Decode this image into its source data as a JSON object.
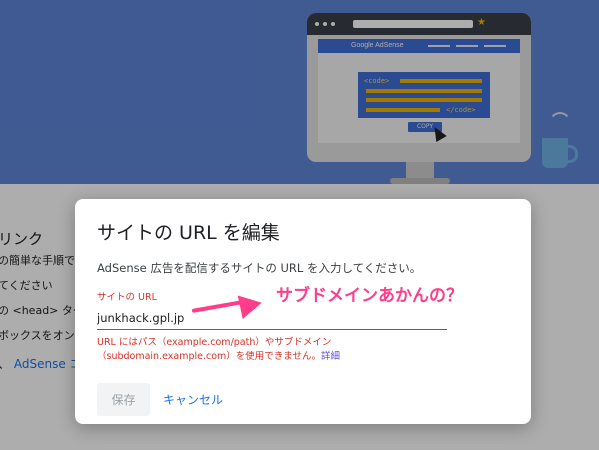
{
  "illustration": {
    "brand_text": "Google AdSense",
    "code_open": "<code>",
    "code_close": "</code>",
    "copy_label": "COPY"
  },
  "background_page": {
    "heading_fragment": "リンク",
    "lines": [
      "の簡単な手順で",
      "てください",
      "の <head> タグ",
      "ボックスをオン"
    ],
    "link_prefix": "、",
    "link_fragment": "AdSense コ"
  },
  "dialog": {
    "title": "サイトの URL を編集",
    "description": "AdSense 広告を配信するサイトの URL を入力してください。",
    "field": {
      "label": "サイトの URL",
      "value": "junkhack.gpl.jp",
      "error_line1": "URL にはパス（example.com/path）やサブドメイン",
      "error_line2": "（subdomain.example.com）を使用できません。",
      "error_link": "詳細"
    },
    "save_label": "保存",
    "cancel_label": "キャンセル"
  },
  "annotation": {
    "text": "サブドメインあかんの？"
  },
  "colors": {
    "hero": "#5f86d8",
    "error": "#d93025",
    "link": "#1a73e8",
    "annotation": "#ff3d8b"
  }
}
